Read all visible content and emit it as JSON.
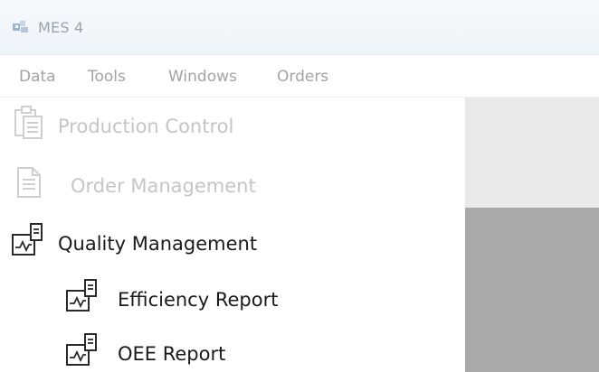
{
  "window": {
    "title": "MES 4",
    "app_icon": "app-icon"
  },
  "menu": {
    "items": [
      {
        "label": "Data"
      },
      {
        "label": "Tools"
      },
      {
        "label": "Windows"
      },
      {
        "label": "Orders"
      }
    ]
  },
  "tree": {
    "items": [
      {
        "label": "Production Control",
        "icon": "clipboard-icon",
        "enabled": false,
        "level": 0
      },
      {
        "label": "Order Management",
        "icon": "document-icon",
        "enabled": false,
        "level": 0
      },
      {
        "label": "Quality Management",
        "icon": "chart-report-icon",
        "enabled": true,
        "level": 0
      },
      {
        "label": "Efficiency Report",
        "icon": "chart-report-icon",
        "enabled": true,
        "level": 1
      },
      {
        "label": "OEE Report",
        "icon": "chart-report-icon",
        "enabled": true,
        "level": 1
      }
    ]
  },
  "colors": {
    "disabled_text": "#c5c5c5",
    "active_text": "#1a1a1a",
    "panel_light": "#e9e9e9",
    "panel_dark": "#a9a9a9"
  }
}
